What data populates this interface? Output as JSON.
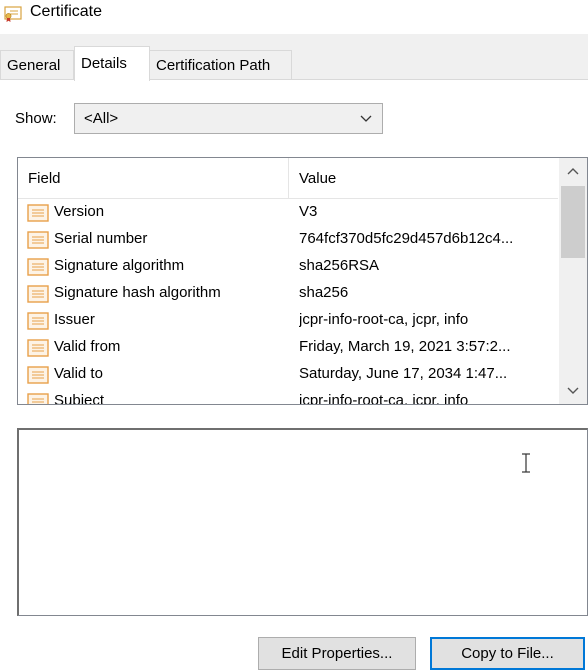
{
  "window": {
    "title": "Certificate",
    "icon": "certificate-icon"
  },
  "tabs": [
    {
      "label": "General",
      "active": false
    },
    {
      "label": "Details",
      "active": true
    },
    {
      "label": "Certification Path",
      "active": false
    }
  ],
  "show": {
    "label": "Show:",
    "selected": "<All>"
  },
  "list": {
    "columns": {
      "field": "Field",
      "value": "Value"
    },
    "rows": [
      {
        "field": "Version",
        "value": "V3"
      },
      {
        "field": "Serial number",
        "value": "764fcf370d5fc29d457d6b12c4..."
      },
      {
        "field": "Signature algorithm",
        "value": "sha256RSA"
      },
      {
        "field": "Signature hash algorithm",
        "value": "sha256"
      },
      {
        "field": "Issuer",
        "value": "jcpr-info-root-ca, jcpr, info"
      },
      {
        "field": "Valid from",
        "value": "Friday, March 19, 2021 3:57:2..."
      },
      {
        "field": "Valid to",
        "value": "Saturday, June 17, 2034 1:47..."
      },
      {
        "field": "Subject",
        "value": "jcpr-info-root-ca, jcpr, info"
      }
    ]
  },
  "detail_text": "",
  "buttons": {
    "edit_properties": "Edit Properties...",
    "copy_to_file": "Copy to File..."
  },
  "colors": {
    "accent": "#0078d7",
    "field_icon": "#e8a04a"
  }
}
